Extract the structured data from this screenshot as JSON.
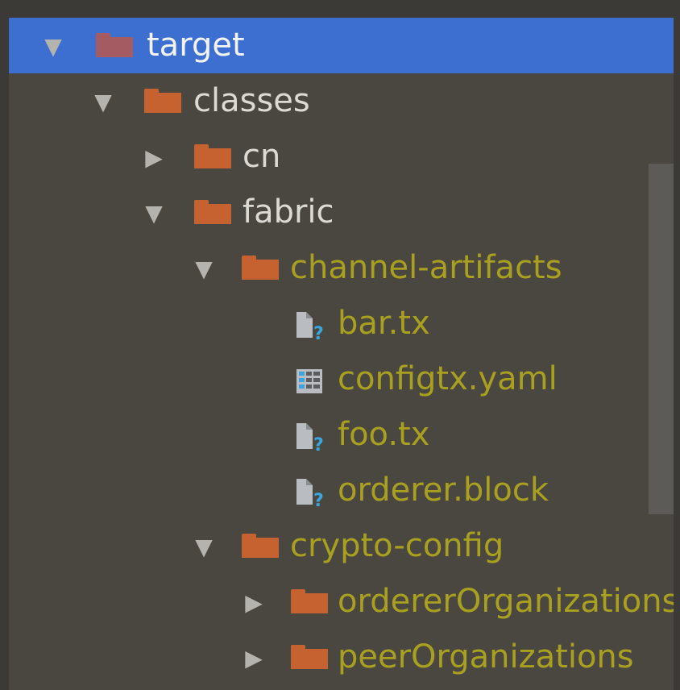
{
  "tree": {
    "rows": [
      {
        "label": "target",
        "arrow": "▼",
        "icon": "folder-icon",
        "selected": true
      },
      {
        "label": "classes",
        "arrow": "▼",
        "icon": "folder-icon"
      },
      {
        "label": "cn",
        "arrow": "▶",
        "icon": "folder-icon"
      },
      {
        "label": "fabric",
        "arrow": "▼",
        "icon": "folder-icon"
      },
      {
        "label": "channel-artifacts",
        "arrow": "▼",
        "icon": "folder-icon"
      },
      {
        "label": "bar.tx",
        "icon": "unknown-file-icon"
      },
      {
        "label": "configtx.yaml",
        "icon": "yaml-file-icon"
      },
      {
        "label": "foo.tx",
        "icon": "unknown-file-icon"
      },
      {
        "label": "orderer.block",
        "icon": "unknown-file-icon"
      },
      {
        "label": "crypto-config",
        "arrow": "▼",
        "icon": "folder-icon"
      },
      {
        "label": "ordererOrganizations",
        "arrow": "▶",
        "icon": "folder-icon"
      },
      {
        "label": "peerOrganizations",
        "arrow": "▶",
        "icon": "folder-icon"
      }
    ]
  },
  "colors": {
    "background": "#4a4741",
    "selection": "#3d6fd0",
    "folder": "#c6622f",
    "text": "#dcdad5",
    "text_modified": "#a9a020"
  }
}
